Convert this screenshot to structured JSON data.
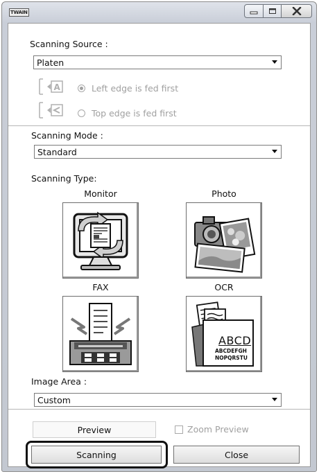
{
  "window": {
    "title_icon_text": "TWAIN",
    "controls": {
      "minimize_icon": "minimize-icon",
      "maximize_icon": "maximize-icon",
      "close_icon": "close-icon"
    }
  },
  "scanning_source": {
    "label": "Scanning Source :",
    "value": "Platen",
    "left_edge_label": "Left edge is fed first",
    "top_edge_label": "Top edge is fed first",
    "left_edge_selected": true
  },
  "scanning_mode": {
    "label": "Scanning Mode :",
    "value": "Standard"
  },
  "scanning_type": {
    "label": "Scanning Type:",
    "options": [
      {
        "label": "Monitor",
        "icon": "monitor-icon"
      },
      {
        "label": "Photo",
        "icon": "photo-icon"
      },
      {
        "label": "FAX",
        "icon": "fax-icon"
      },
      {
        "label": "OCR",
        "icon": "ocr-icon"
      }
    ],
    "ocr_text_large": "ABCD",
    "ocr_text_small_1": "ABCDEFGH",
    "ocr_text_small_2": "NOPQRSTU"
  },
  "image_area": {
    "label": "Image Area :",
    "value": "Custom"
  },
  "buttons": {
    "preview": "Preview",
    "zoom_preview": "Zoom Preview",
    "scanning": "Scanning",
    "close": "Close"
  }
}
